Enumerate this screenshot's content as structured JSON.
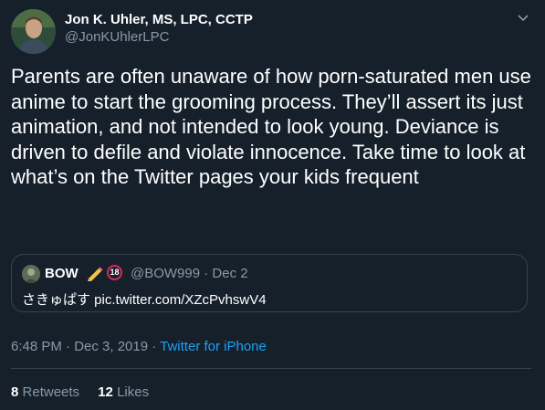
{
  "author": {
    "display_name": "Jon K. Uhler, MS, LPC, CCTP",
    "handle": "@JonKUhlerLPC"
  },
  "tweet": {
    "text": "Parents are often unaware of how porn-saturated men use anime to start the grooming process. They’ll assert its just animation, and not intended to look young. Deviance is driven to defile and violate innocence. Take time to look at what’s on the Twitter pages your kids frequent"
  },
  "quote": {
    "display_name": "BOW",
    "badge_text": "18",
    "handle_date": "@BOW999 · Dec 2",
    "text": "さきゅぱす pic.twitter.com/XZcPvhswV4"
  },
  "meta": {
    "time_date": "6:48 PM · Dec 3, 2019 · ",
    "source": "Twitter for iPhone"
  },
  "stats": {
    "retweets_count": "8",
    "retweets_label": "Retweets",
    "likes_count": "12",
    "likes_label": "Likes"
  },
  "icons": [
    "avatar",
    "chevron-down-icon",
    "pencil-icon",
    "no-under-18-icon"
  ],
  "colors": {
    "background": "#15202b",
    "secondary_text": "#8899a6",
    "link": "#1da1f2",
    "border": "#38444d"
  }
}
